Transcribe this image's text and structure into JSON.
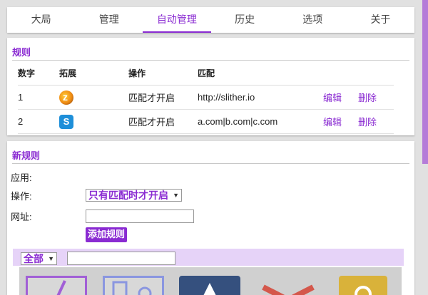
{
  "tabs": [
    "大局",
    "管理",
    "自动管理",
    "历史",
    "选项",
    "关于"
  ],
  "active_tab": 2,
  "rules_panel": {
    "title": "规则",
    "headers": [
      "数字",
      "拓展",
      "操作",
      "匹配"
    ],
    "rows": [
      {
        "num": "1",
        "icon": "slither-extension-icon",
        "action": "匹配才开启",
        "match": "http://slither.io",
        "edit": "编辑",
        "delete": "删除"
      },
      {
        "num": "2",
        "icon": "s-extension-icon",
        "action": "匹配才开启",
        "match": "a.com|b.com|c.com",
        "edit": "编辑",
        "delete": "删除"
      }
    ]
  },
  "new_rule_panel": {
    "title": "新规则",
    "apply_label": "应用:",
    "action_label": "操作:",
    "action_value": "只有匹配时才开启",
    "url_label": "网址:",
    "url_value": "",
    "add_button": "添加规则",
    "filter_value": "全部",
    "filter_search_value": ""
  },
  "colors": {
    "accent": "#8a2bd2",
    "filter_bar": "#e6d3f8"
  }
}
